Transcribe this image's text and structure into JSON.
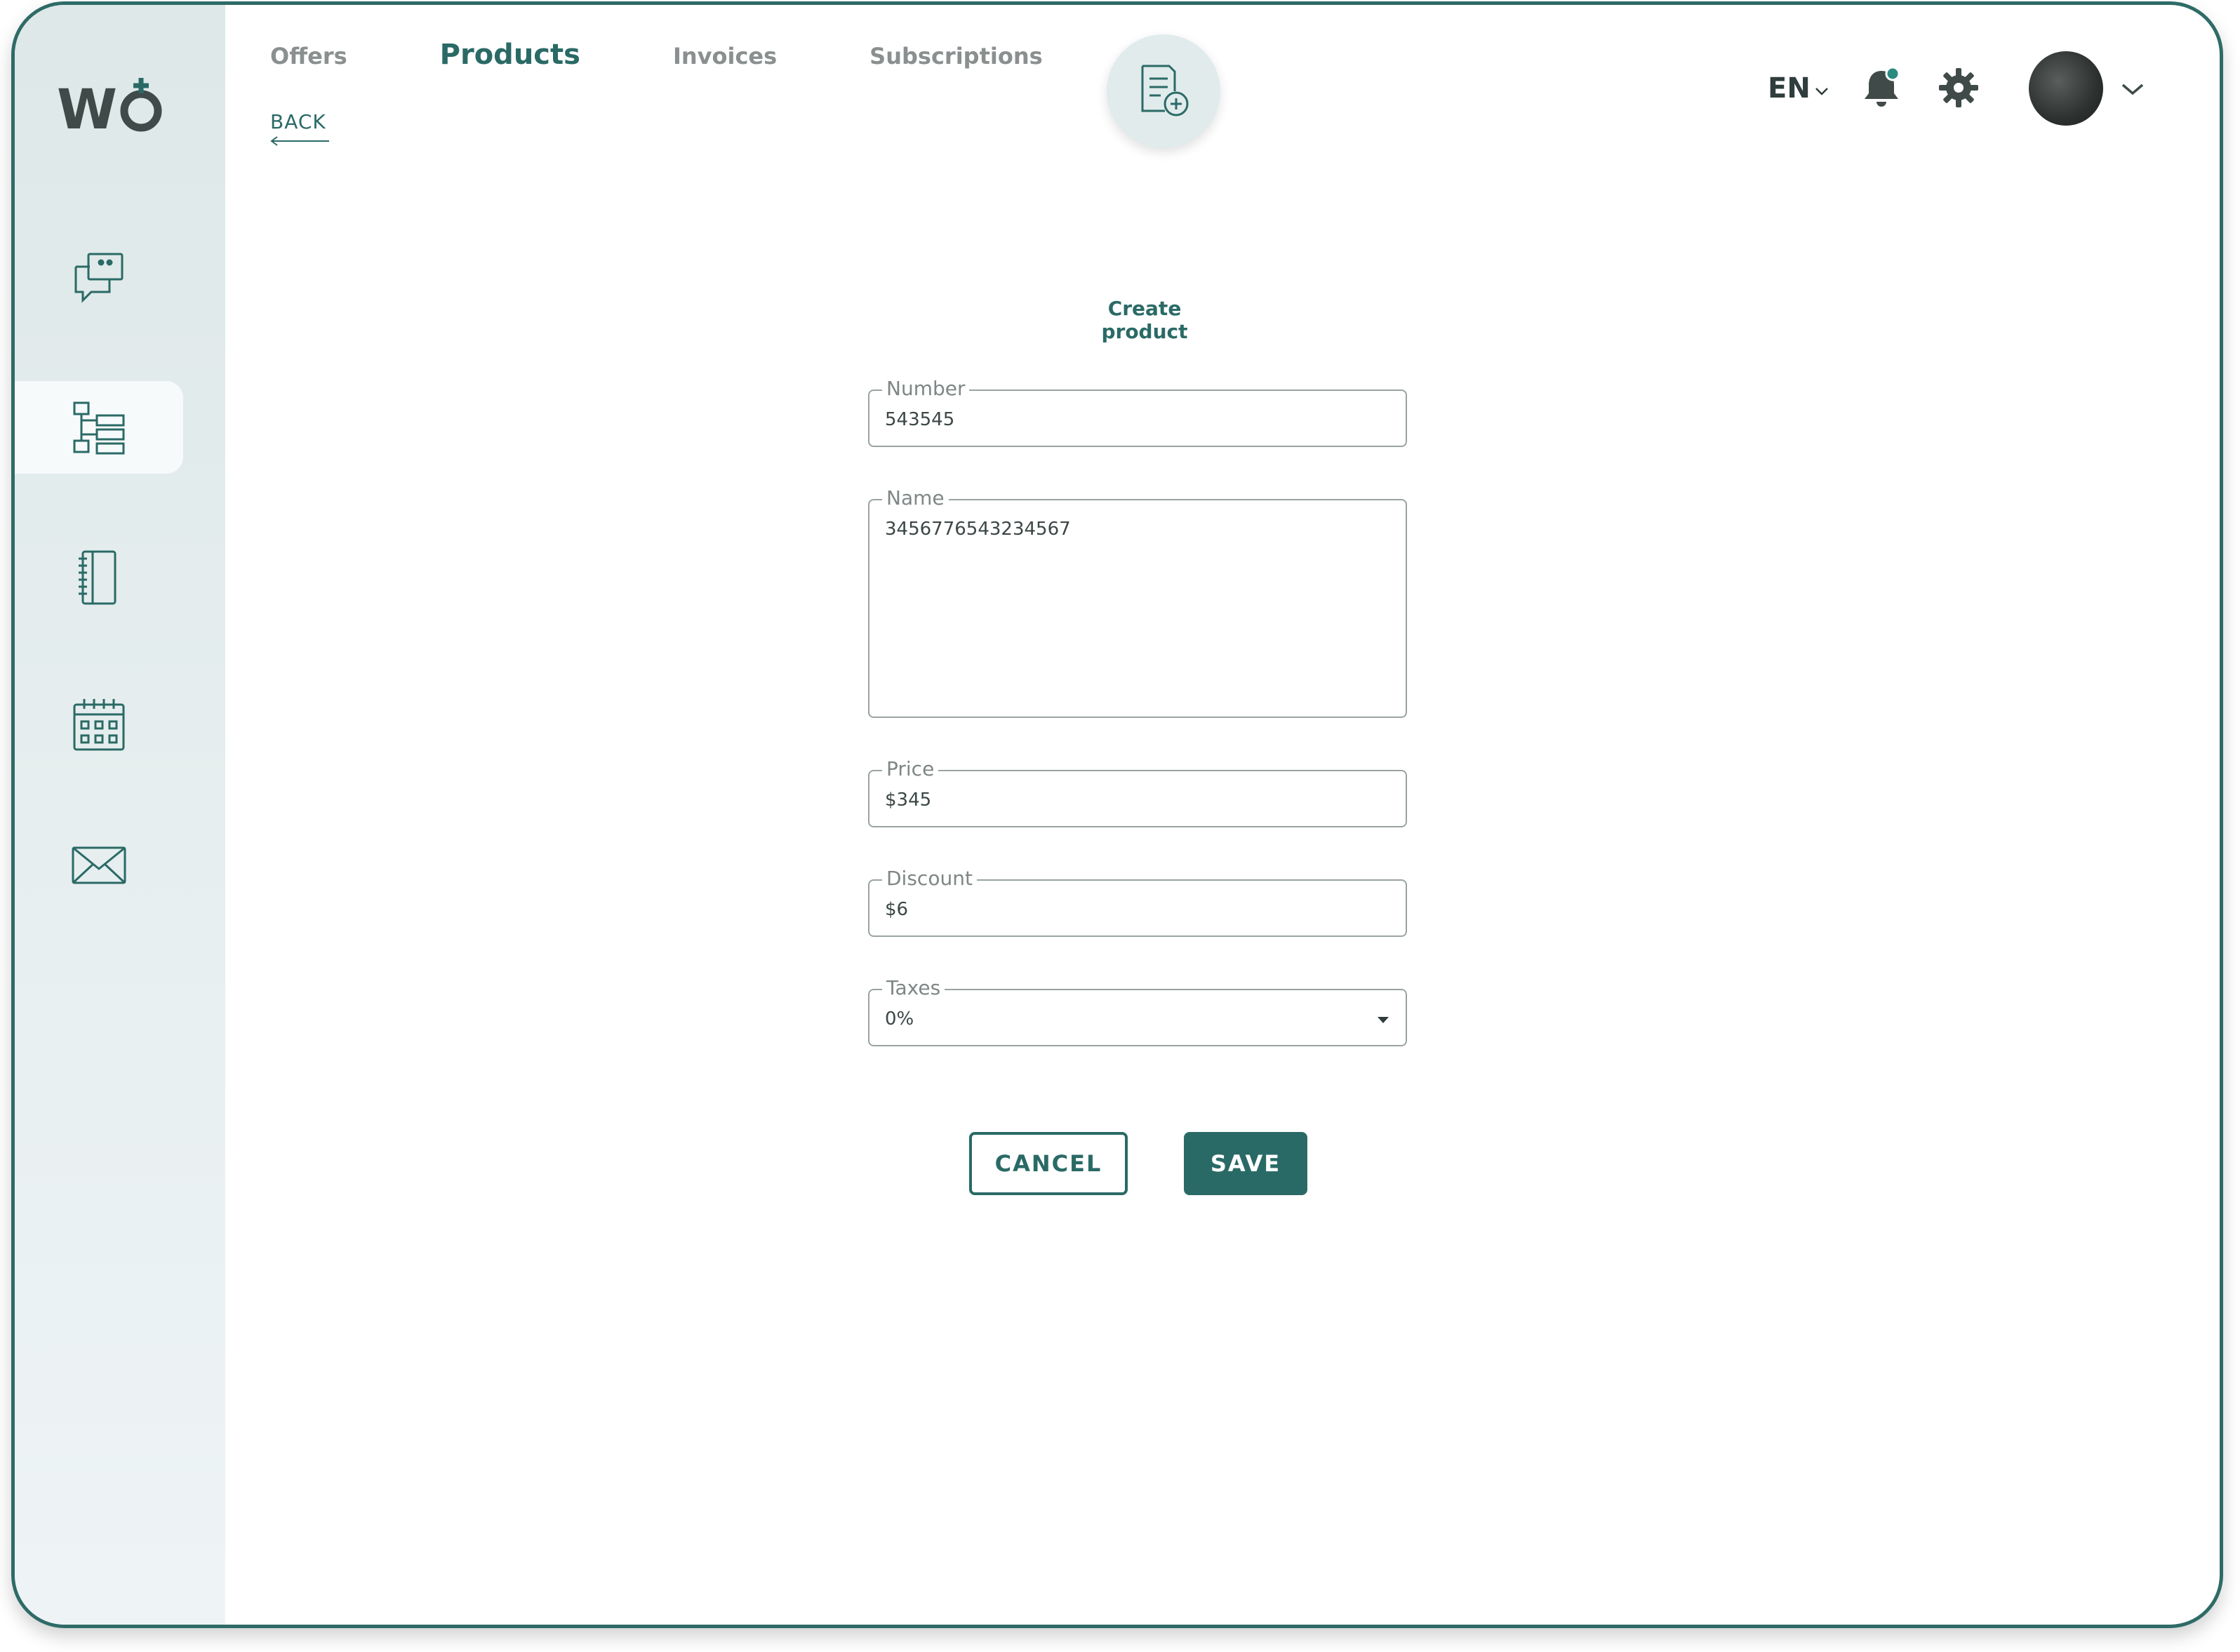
{
  "brand": {
    "logo_text": "WO",
    "accent": "#2a6a66"
  },
  "nav": {
    "tabs": [
      {
        "label": "Offers"
      },
      {
        "label": "Products",
        "active": true
      },
      {
        "label": "Invoices"
      },
      {
        "label": "Subscriptions"
      }
    ],
    "back_label": "BACK"
  },
  "sidebar": {
    "items": [
      {
        "icon": "chat-icon"
      },
      {
        "icon": "hierarchy-icon",
        "active": true
      },
      {
        "icon": "notebook-icon"
      },
      {
        "icon": "calendar-icon"
      },
      {
        "icon": "mail-icon"
      }
    ]
  },
  "header": {
    "language": "EN",
    "fab_icon": "document-add-icon"
  },
  "form": {
    "title": "Create product",
    "number": {
      "label": "Number",
      "value": "543545"
    },
    "name": {
      "label": "Name",
      "value": "3456776543234567"
    },
    "price": {
      "label": "Price",
      "value": "$345"
    },
    "discount": {
      "label": "Discount",
      "value": "$6"
    },
    "taxes": {
      "label": "Taxes",
      "value": "0%"
    },
    "cancel_label": "CANCEL",
    "save_label": "SAVE"
  }
}
